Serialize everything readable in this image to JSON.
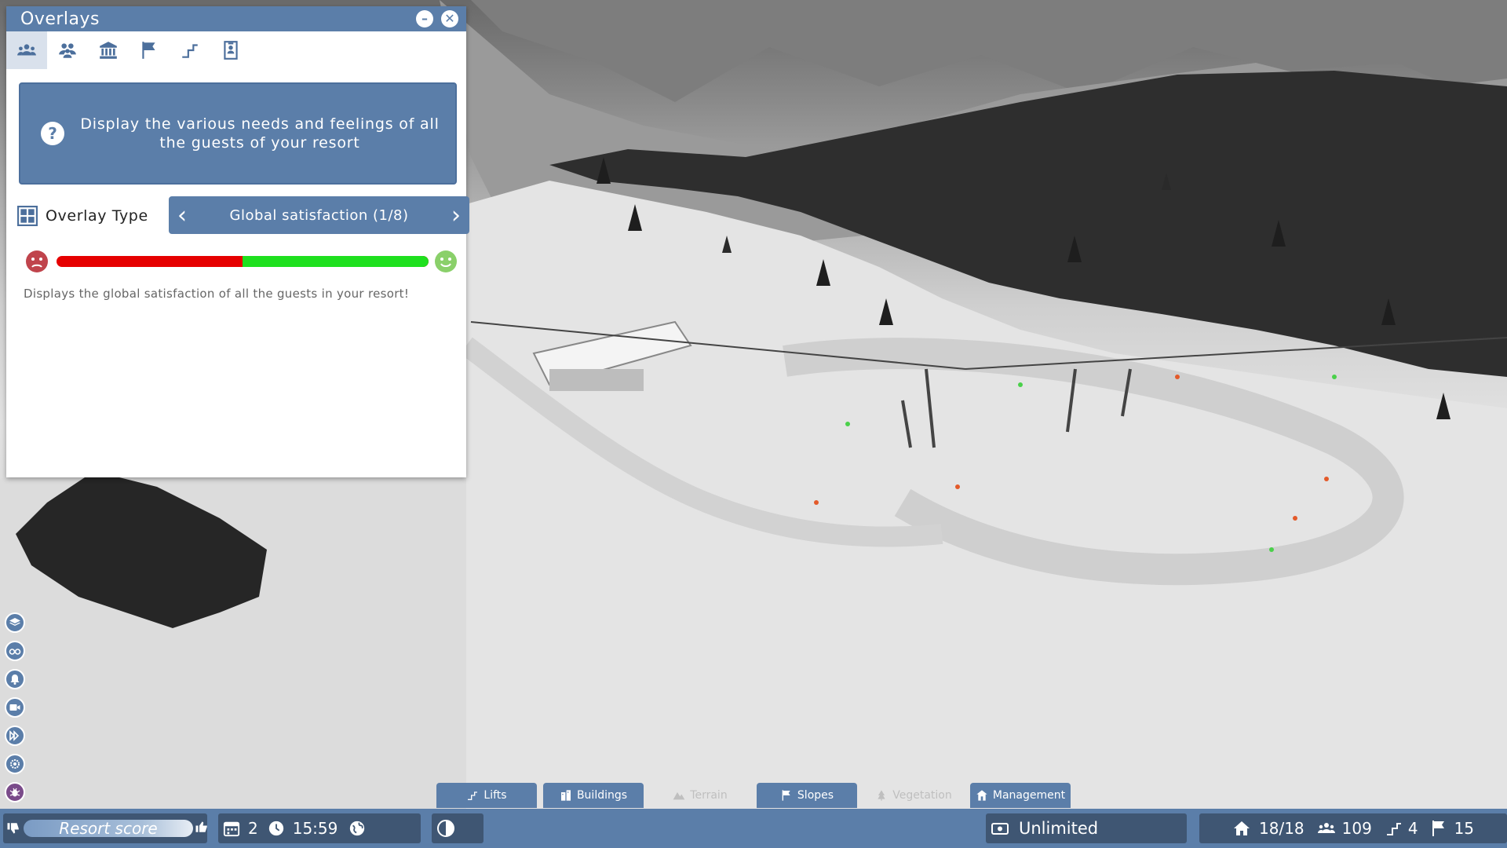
{
  "panel": {
    "title": "Overlays",
    "tabs": [
      {
        "name": "guests-needs",
        "icon": "guests-icon",
        "active": true
      },
      {
        "name": "groups",
        "icon": "groups-icon",
        "active": false
      },
      {
        "name": "buildings",
        "icon": "building-icon",
        "active": false
      },
      {
        "name": "slopes",
        "icon": "flag-icon",
        "active": false
      },
      {
        "name": "lifts",
        "icon": "lift-icon",
        "active": false
      },
      {
        "name": "staff",
        "icon": "badge-icon",
        "active": false
      }
    ],
    "info_text": "Display the  various needs and feelings of all the guests of your resort",
    "overlay_type_label": "Overlay Type",
    "overlay_value": "Global satisfaction (1/8)",
    "satisfaction_low_fraction": 0.5,
    "description": "Displays the global satisfaction of all the guests in your resort!"
  },
  "side_toolbar": [
    "layers-icon",
    "binoculars-icon",
    "bell-icon",
    "camera-icon",
    "fast-forward-icon",
    "settings-icon",
    "bug-icon"
  ],
  "categories": [
    {
      "label": "Lifts",
      "icon": "lift-icon",
      "enabled": true
    },
    {
      "label": "Buildings",
      "icon": "building-icon",
      "enabled": true
    },
    {
      "label": "Terrain",
      "icon": "mountain-icon",
      "enabled": false
    },
    {
      "label": "Slopes",
      "icon": "flag-icon",
      "enabled": true
    },
    {
      "label": "Vegetation",
      "icon": "tree-icon",
      "enabled": false
    },
    {
      "label": "Management",
      "icon": "management-icon",
      "enabled": true
    }
  ],
  "status": {
    "score_label": "Resort score",
    "day": "2",
    "time": "15:59",
    "budget": "Unlimited",
    "buildings": "18/18",
    "guests": "109",
    "lifts": "4",
    "slopes": "15"
  },
  "colors": {
    "ui_blue": "#5b7ea9",
    "ui_dark": "#3f5673",
    "bar_red": "#e60000",
    "bar_green": "#1ee01e",
    "happy": "#8ad06a",
    "sad": "#c0444c"
  }
}
